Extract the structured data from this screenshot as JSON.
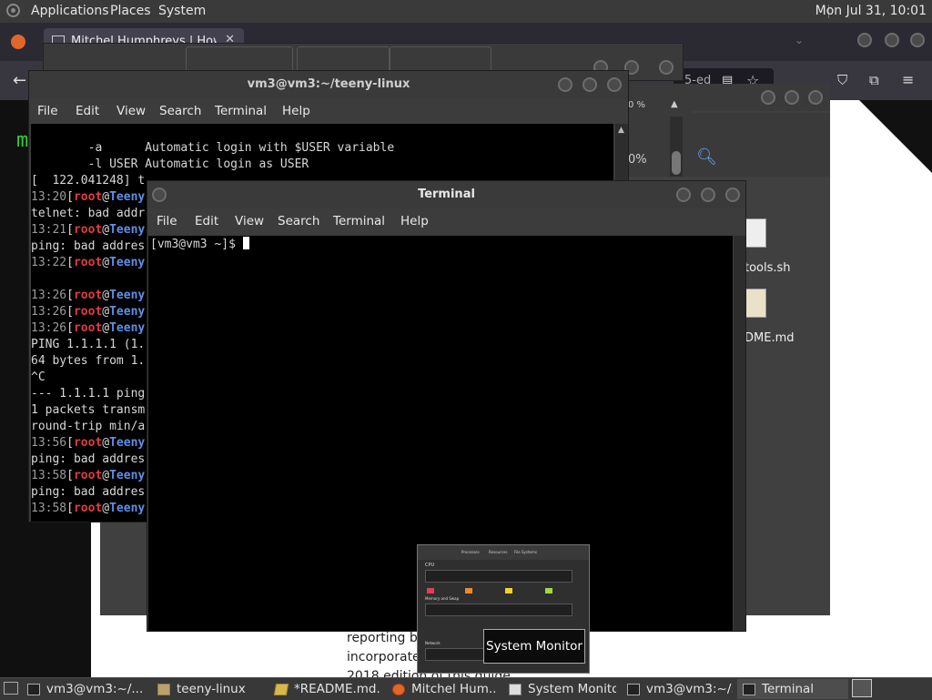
{
  "top_panel": {
    "applications": "Applications",
    "places": "Places",
    "system": "System",
    "clock": "Mon Jul 31, 10:01"
  },
  "firefox": {
    "tab_title": "Mitchel Humphreys | How I",
    "url_fragment": "5-ed",
    "page_text": [
      "reporting b",
      "incorporate",
      "2018 edition of this guide"
    ]
  },
  "terminal_back": {
    "title": "vm3@vm3:~/teeny-linux",
    "menu": [
      "File",
      "Edit",
      "View",
      "Search",
      "Terminal",
      "Help"
    ],
    "lines": [
      {
        "type": "plain",
        "text": "        -a      Automatic login with $USER variable"
      },
      {
        "type": "plain",
        "text": "        -l USER Automatic login as USER"
      },
      {
        "type": "plain",
        "text": "[  122.041248] t"
      },
      {
        "type": "prompt",
        "time": "13:20",
        "user": "root",
        "host": "Teeny"
      },
      {
        "type": "plain",
        "text": "telnet: bad addr"
      },
      {
        "type": "prompt",
        "time": "13:21",
        "user": "root",
        "host": "Teeny"
      },
      {
        "type": "plain",
        "text": "ping: bad addres"
      },
      {
        "type": "prompt",
        "time": "13:22",
        "user": "root",
        "host": "Teeny"
      },
      {
        "type": "plain",
        "text": ""
      },
      {
        "type": "prompt",
        "time": "13:26",
        "user": "root",
        "host": "Teeny"
      },
      {
        "type": "prompt",
        "time": "13:26",
        "user": "root",
        "host": "Teeny"
      },
      {
        "type": "prompt",
        "time": "13:26",
        "user": "root",
        "host": "Teeny"
      },
      {
        "type": "plain",
        "text": "PING 1.1.1.1 (1."
      },
      {
        "type": "plain",
        "text": "64 bytes from 1."
      },
      {
        "type": "plain",
        "text": "^C"
      },
      {
        "type": "plain",
        "text": "--- 1.1.1.1 ping"
      },
      {
        "type": "plain",
        "text": "1 packets transm"
      },
      {
        "type": "plain",
        "text": "round-trip min/a"
      },
      {
        "type": "prompt",
        "time": "13:56",
        "user": "root",
        "host": "Teeny"
      },
      {
        "type": "plain",
        "text": "ping: bad addres"
      },
      {
        "type": "prompt",
        "time": "13:58",
        "user": "root",
        "host": "Teeny"
      },
      {
        "type": "plain",
        "text": "ping: bad addres"
      },
      {
        "type": "prompt",
        "time": "13:58",
        "user": "root",
        "host": "Teeny"
      }
    ]
  },
  "file_manager": {
    "files": [
      "tools.sh",
      "DME.md"
    ],
    "percent_top": "0 %",
    "percent_mid": "0%"
  },
  "terminal_front": {
    "title": "Terminal",
    "menu": [
      "File",
      "Edit",
      "View",
      "Search",
      "Terminal",
      "Help"
    ],
    "prompt": "[vm3@vm3 ~]$ "
  },
  "sysmon": {
    "tooltip": "System Monitor",
    "tabs": [
      "Processes",
      "Resources",
      "File Systems"
    ],
    "cpu_label": "CPU",
    "mem_label": "Memory and Swap",
    "net_label": "Network",
    "legend_colors": [
      "#e23c5a",
      "#f08a24",
      "#f5d02a",
      "#a3d93a"
    ]
  },
  "taskbar": [
    {
      "label": "vm3@vm3:~/...",
      "icon": "terminal-icon",
      "active": false
    },
    {
      "label": "teeny-linux",
      "icon": "folder-icon",
      "active": false
    },
    {
      "label": "*README.md...",
      "icon": "text-editor-icon",
      "active": false
    },
    {
      "label": "Mitchel Hum...",
      "icon": "firefox-icon",
      "active": false
    },
    {
      "label": "System Monitor",
      "icon": "system-monitor-icon",
      "active": false
    },
    {
      "label": "vm3@vm3:~/...",
      "icon": "terminal-icon",
      "active": false
    },
    {
      "label": "Terminal",
      "icon": "terminal-icon",
      "active": true
    }
  ]
}
